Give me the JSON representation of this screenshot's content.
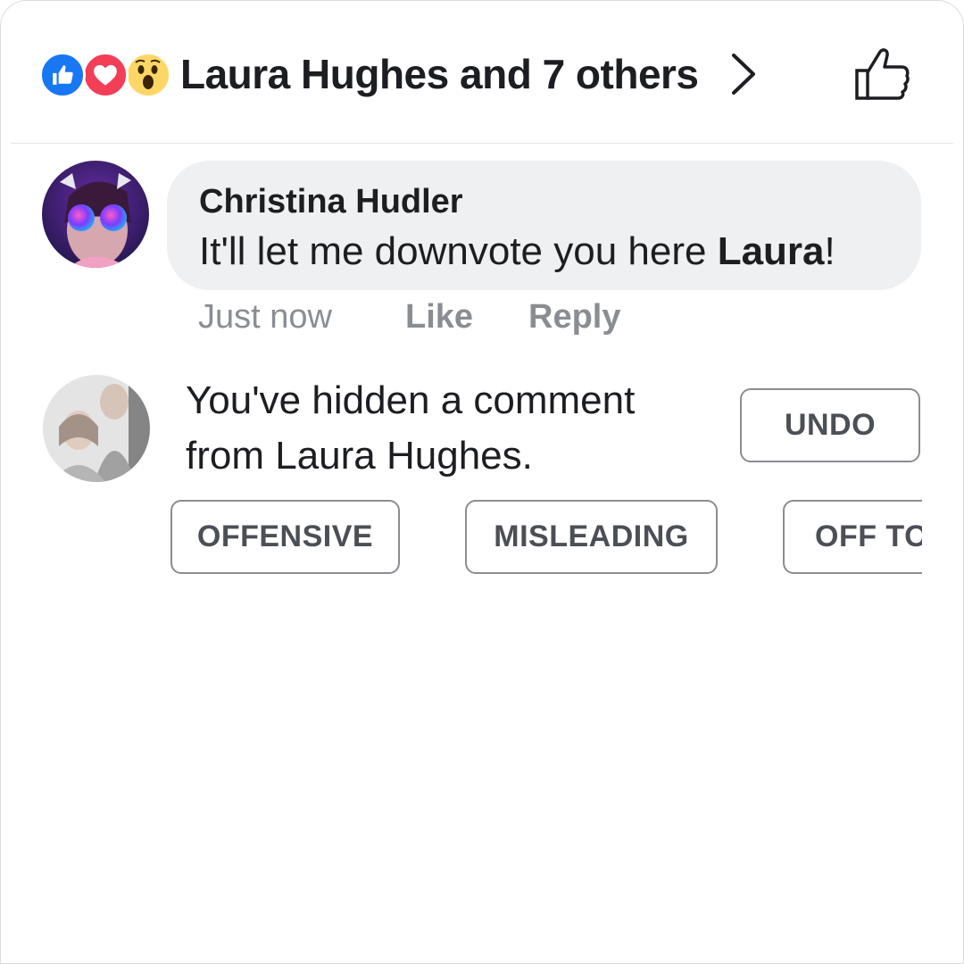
{
  "header": {
    "reactions": [
      {
        "name": "like-reaction-icon",
        "color": "#1877f2"
      },
      {
        "name": "love-reaction-icon",
        "color": "#f33e58"
      },
      {
        "name": "wow-reaction-icon",
        "color": "#fdd766"
      }
    ],
    "title": "Laura Hughes and 7 others"
  },
  "comment": {
    "author": "Christina Hudler",
    "text_prefix": "It'll let me downvote you here ",
    "text_mention": "Laura",
    "text_suffix": "!",
    "time": "Just now",
    "like_label": "Like",
    "reply_label": "Reply"
  },
  "hidden_comment": {
    "message_line1": "You've hidden a comment",
    "message_line2": "from Laura Hughes.",
    "undo_label": "UNDO",
    "reasons": [
      "OFFENSIVE",
      "MISLEADING",
      "OFF TO"
    ]
  }
}
